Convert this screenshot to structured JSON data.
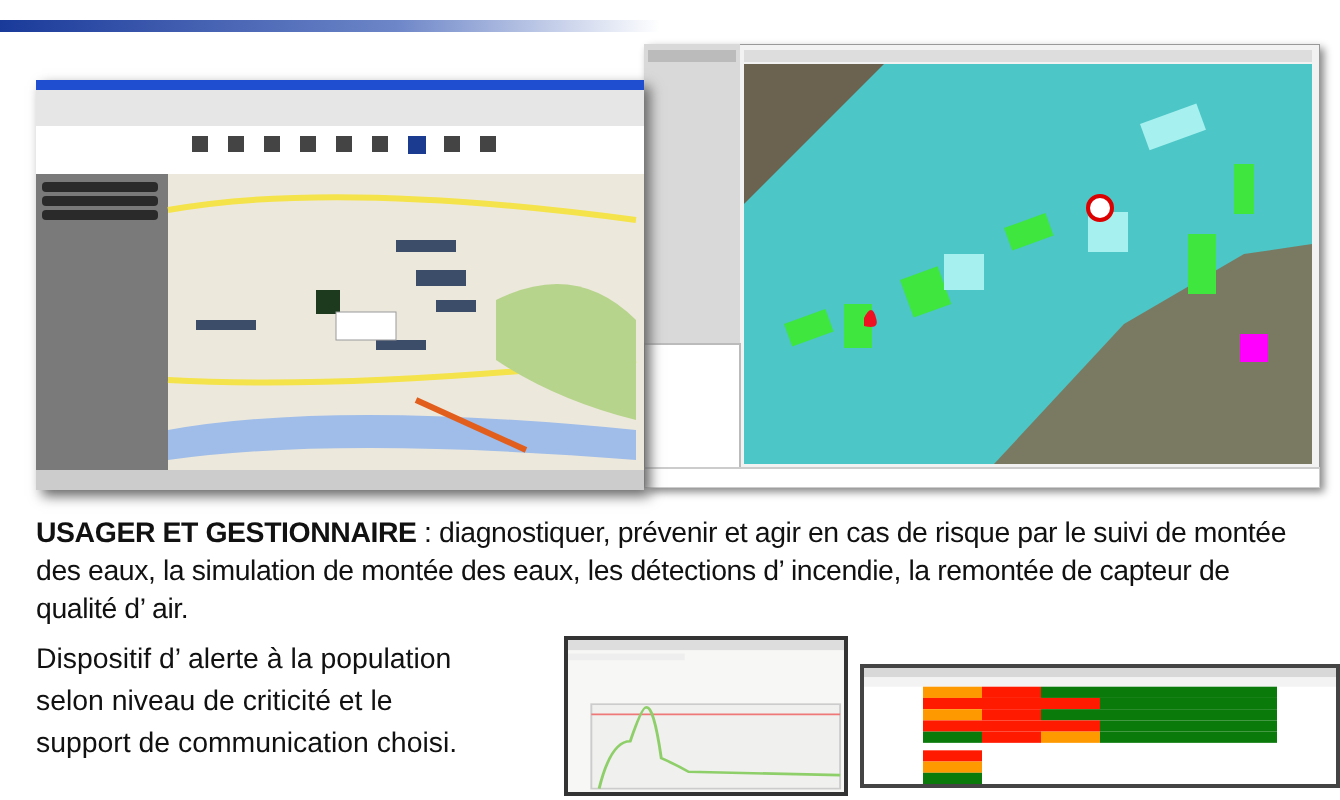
{
  "description": "**USAGER ET GESTIONNAIRE**  : diagnostiquer, prévenir et agir en cas de risque par le suivi de montée des eaux, la simulation de montée des eaux, les détections d’ incendie, la remontée de capteur de qualité d’ air.",
  "alert_text": "Dispositif d’ alerte à la population selon niveau de criticité et le support de communication choisi.",
  "heatmap": {
    "rows": [
      {
        "cells": [
          {
            "color": "#ff9900"
          },
          {
            "color": "#ff1a00"
          },
          {
            "color": "#0a7a0a"
          },
          {
            "color": "#0a7a0a"
          },
          {
            "color": "#0a7a0a"
          },
          {
            "color": "#0a7a0a"
          }
        ]
      },
      {
        "cells": [
          {
            "color": "#ff1a00"
          },
          {
            "color": "#ff1a00"
          },
          {
            "color": "#ff1a00"
          },
          {
            "color": "#0a7a0a"
          },
          {
            "color": "#0a7a0a"
          },
          {
            "color": "#0a7a0a"
          }
        ]
      },
      {
        "cells": [
          {
            "color": "#ff9900"
          },
          {
            "color": "#ff1a00"
          },
          {
            "color": "#0a7a0a"
          },
          {
            "color": "#0a7a0a"
          },
          {
            "color": "#0a7a0a"
          },
          {
            "color": "#0a7a0a"
          }
        ]
      },
      {
        "cells": [
          {
            "color": "#ff1a00"
          },
          {
            "color": "#ff1a00"
          },
          {
            "color": "#ff1a00"
          },
          {
            "color": "#0a7a0a"
          },
          {
            "color": "#0a7a0a"
          },
          {
            "color": "#0a7a0a"
          }
        ]
      },
      {
        "cells": [
          {
            "color": "#0a7a0a"
          },
          {
            "color": "#ff1a00"
          },
          {
            "color": "#ff9900"
          },
          {
            "color": "#0a7a0a"
          },
          {
            "color": "#0a7a0a"
          },
          {
            "color": "#0a7a0a"
          }
        ]
      }
    ],
    "legend": [
      {
        "color": "#ff1a00"
      },
      {
        "color": "#ff9900"
      },
      {
        "color": "#0a7a0a"
      }
    ]
  }
}
